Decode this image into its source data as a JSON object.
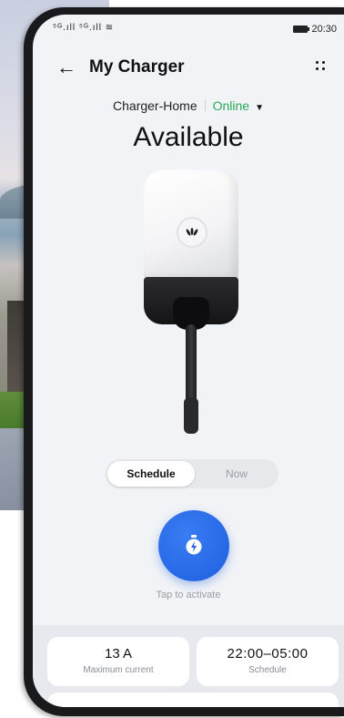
{
  "status_bar": {
    "signal": "⁵ᴳ.ıll ⁵ᴳ.ıll ≋",
    "time": "20:30"
  },
  "appbar": {
    "title": "My Charger",
    "back_icon": "arrow-left-icon",
    "more_icon": "more-dots-icon"
  },
  "device": {
    "name": "Charger-Home",
    "status": "Online",
    "status_color": "#29a85a"
  },
  "state": "Available",
  "mode_toggle": {
    "options": [
      "Schedule",
      "Now"
    ],
    "selected": "Schedule"
  },
  "activate": {
    "hint": "Tap to activate",
    "color": "#1f5fe0"
  },
  "cards": [
    {
      "value": "13 A",
      "label": "Maximum current"
    },
    {
      "value": "22:00–05:00",
      "label": "Schedule"
    }
  ]
}
